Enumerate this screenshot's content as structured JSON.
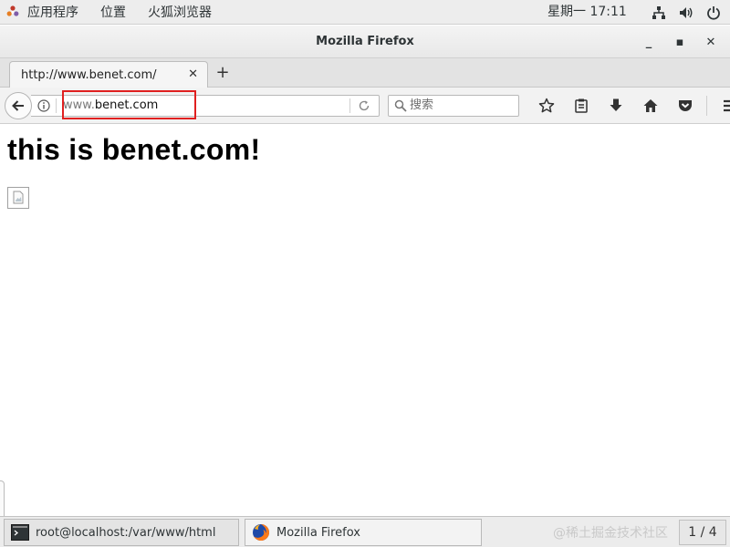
{
  "topbar": {
    "apps_label": "应用程序",
    "places_label": "位置",
    "firefox_label": "火狐浏览器",
    "clock": "星期一 17:11"
  },
  "window": {
    "title": "Mozilla Firefox",
    "minimize": "_",
    "maximize": "▪",
    "close": "✕"
  },
  "tab": {
    "title": "http://www.benet.com/",
    "close": "✕",
    "new_tab": "+"
  },
  "navbar": {
    "url_prefix": "www.",
    "url_host": "benet.com",
    "search_placeholder": "搜索"
  },
  "page": {
    "heading": "this is benet.com!"
  },
  "taskbar": {
    "items": [
      {
        "label": "root@localhost:/var/www/html",
        "icon": "terminal-icon"
      },
      {
        "label": "Mozilla Firefox",
        "icon": "firefox-icon"
      }
    ],
    "watermark": "@稀土掘金技术社区",
    "pager": "1 / 4"
  },
  "colors": {
    "highlight_border": "#e02020"
  }
}
